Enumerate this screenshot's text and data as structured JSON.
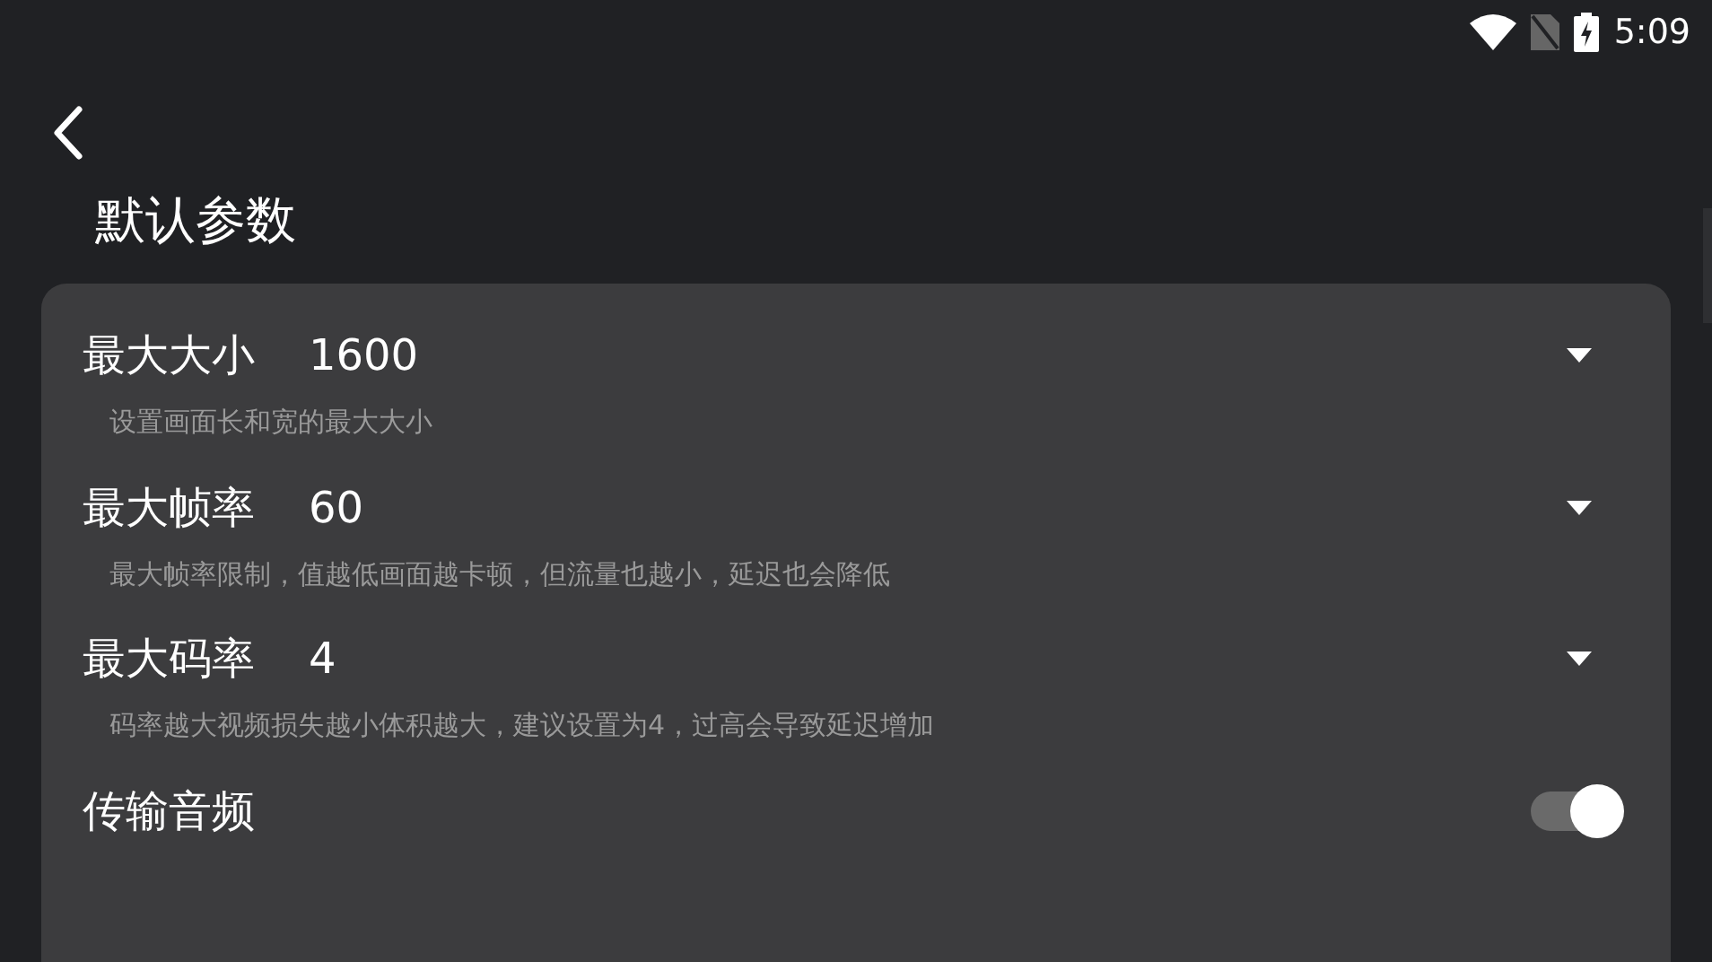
{
  "status_bar": {
    "time": "5:09"
  },
  "title": "默认参数",
  "settings": [
    {
      "kind": "dropdown",
      "label": "最大大小",
      "value": "1600",
      "description": "设置画面长和宽的最大大小"
    },
    {
      "kind": "dropdown",
      "label": "最大帧率",
      "value": "60",
      "description": "最大帧率限制，值越低画面越卡顿，但流量也越小，延迟也会降低"
    },
    {
      "kind": "dropdown",
      "label": "最大码率",
      "value": "4",
      "description": "码率越大视频损失越小体积越大，建议设置为4，过高会导致延迟增加"
    },
    {
      "kind": "switch",
      "label": "传输音频",
      "on": true
    }
  ]
}
